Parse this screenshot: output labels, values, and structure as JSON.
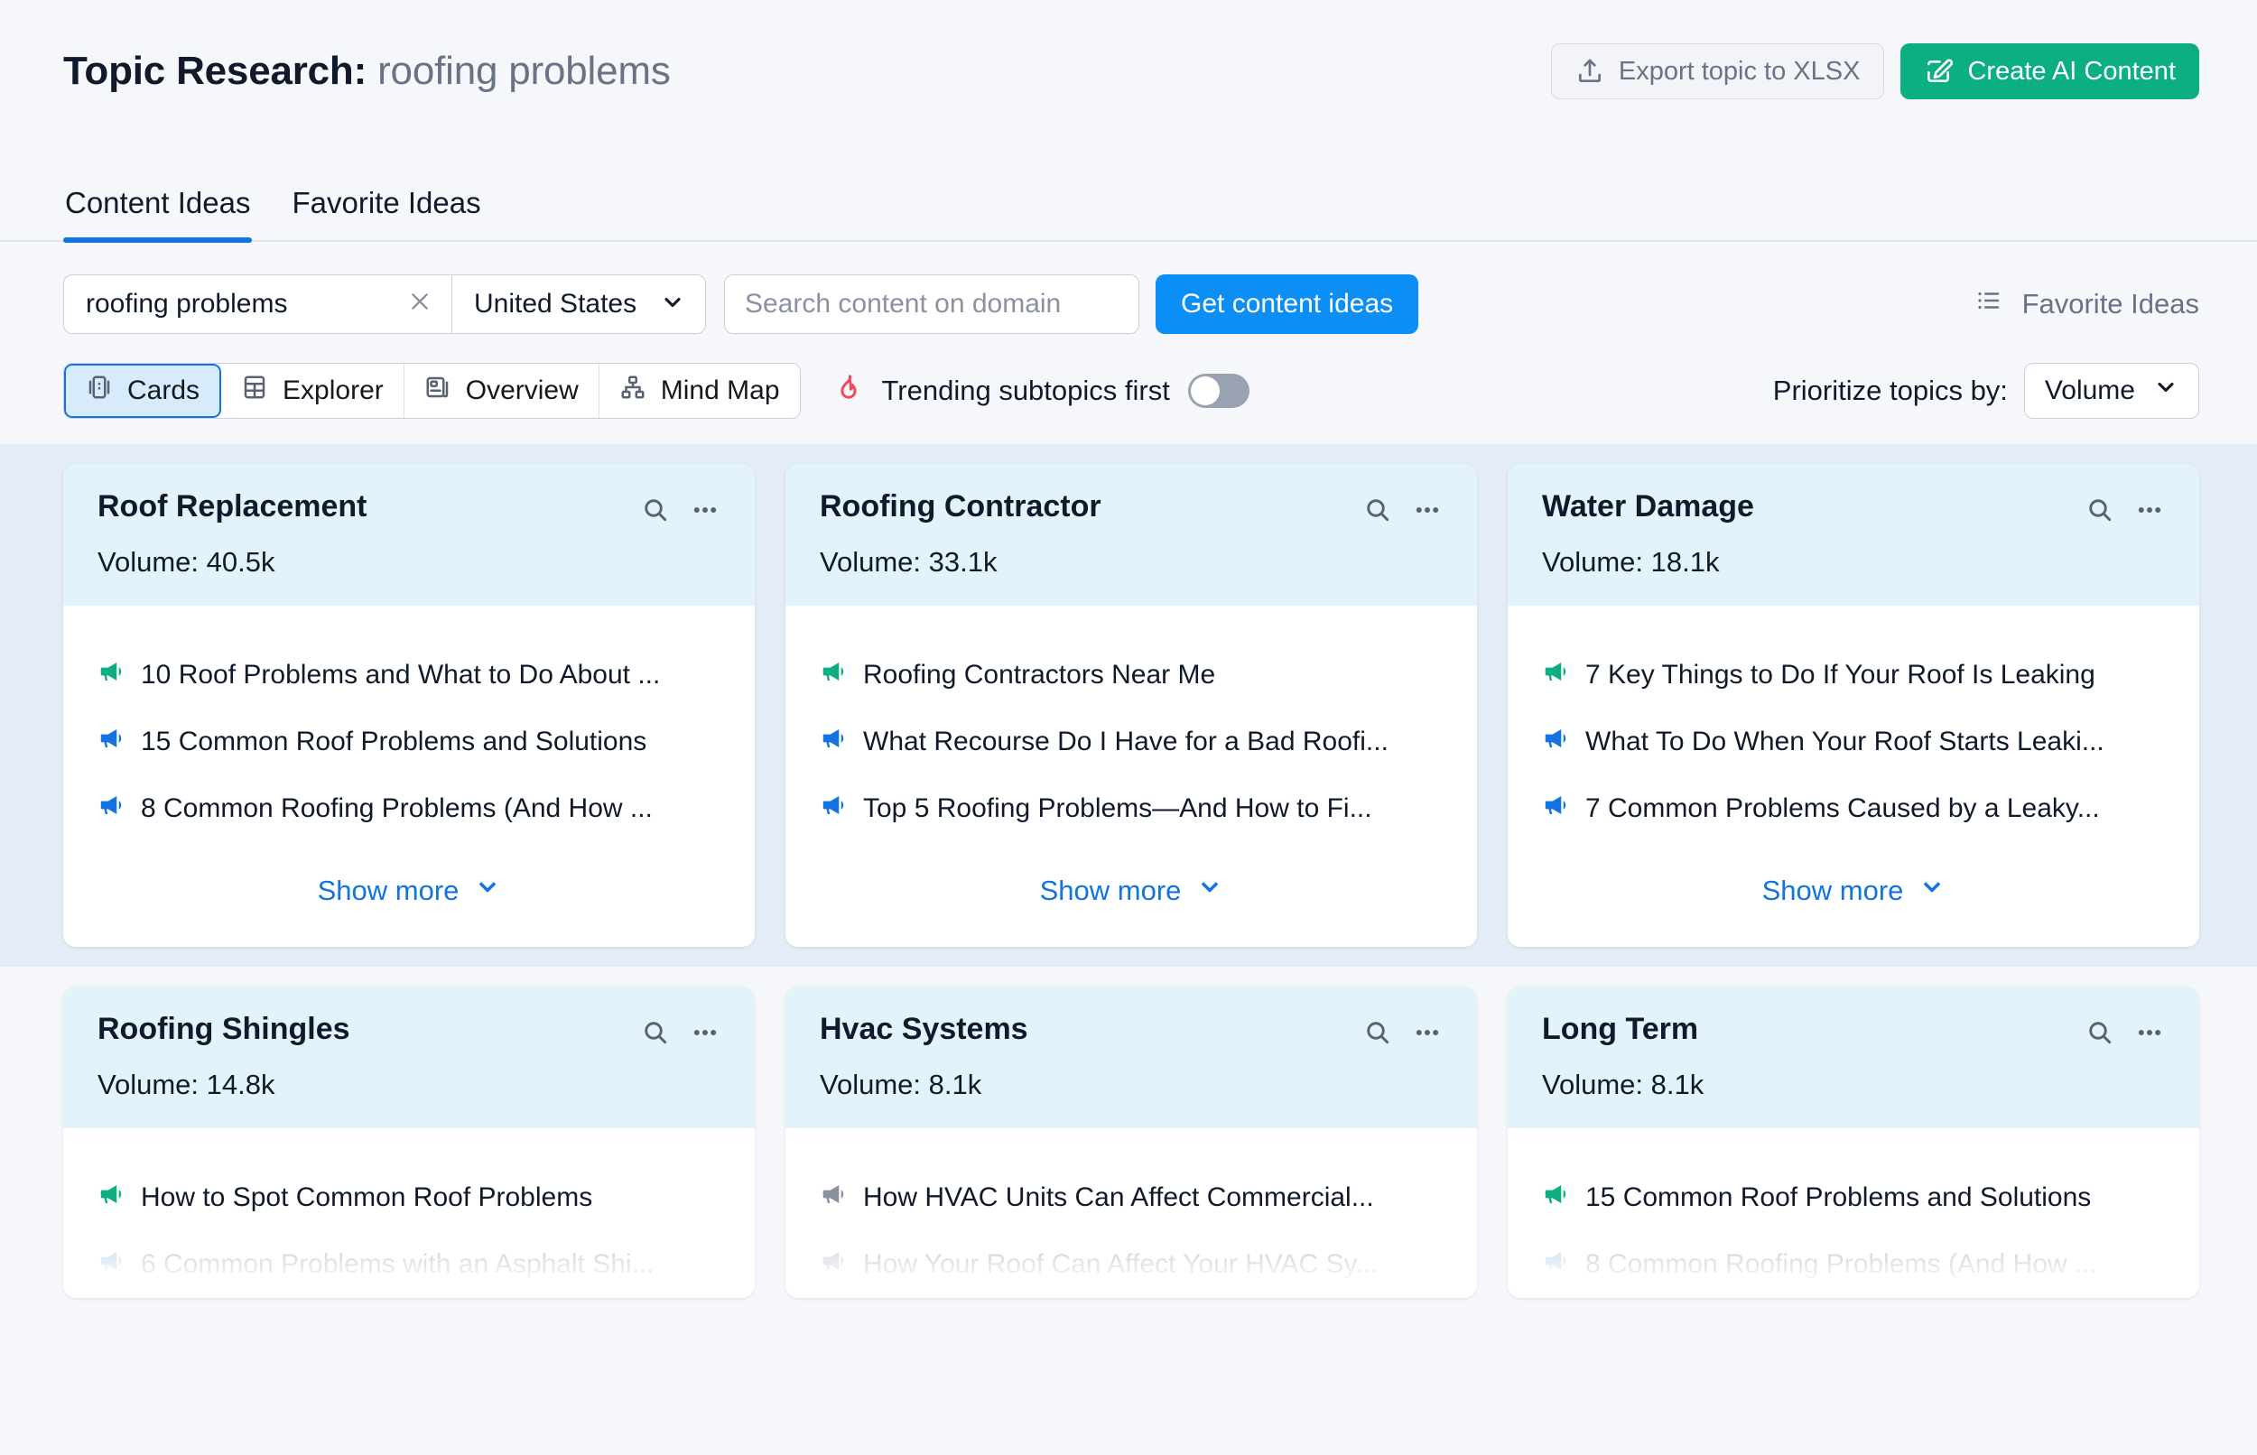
{
  "header": {
    "title_prefix": "Topic Research:",
    "title_keyword": "roofing problems",
    "export_label": "Export topic to XLSX",
    "create_label": "Create AI Content"
  },
  "tabs": [
    {
      "label": "Content Ideas",
      "active": true
    },
    {
      "label": "Favorite Ideas",
      "active": false
    }
  ],
  "controls": {
    "keyword_value": "roofing problems",
    "country_value": "United States",
    "domain_placeholder": "Search content on domain",
    "domain_value": "",
    "get_ideas_label": "Get content ideas",
    "favorite_ideas_label": "Favorite Ideas",
    "views": [
      {
        "label": "Cards",
        "icon": "cards-icon",
        "active": true
      },
      {
        "label": "Explorer",
        "icon": "table-icon",
        "active": false
      },
      {
        "label": "Overview",
        "icon": "overview-icon",
        "active": false
      },
      {
        "label": "Mind Map",
        "icon": "mindmap-icon",
        "active": false
      }
    ],
    "trending_label": "Trending subtopics first",
    "trending_enabled": false,
    "prioritize_label": "Prioritize topics by:",
    "prioritize_value": "Volume"
  },
  "colors": {
    "accent_blue": "#1274e0",
    "button_blue": "#0b8ef5",
    "brand_green": "#0caf81",
    "flame_red": "#f8455a",
    "card_header": "#e3f3fc",
    "highlight_band": "#e4ecf7"
  },
  "show_more_label": "Show more",
  "cards": [
    {
      "title": "Roof Replacement",
      "volume": "Volume: 40.5k",
      "ideas": [
        {
          "text": "10 Roof Problems and What to Do About ...",
          "tone": "green"
        },
        {
          "text": "15 Common Roof Problems and Solutions",
          "tone": "blue"
        },
        {
          "text": "8 Common Roofing Problems (And How ...",
          "tone": "blue"
        }
      ]
    },
    {
      "title": "Roofing Contractor",
      "volume": "Volume: 33.1k",
      "ideas": [
        {
          "text": "Roofing Contractors Near Me",
          "tone": "green"
        },
        {
          "text": "What Recourse Do I Have for a Bad Roofi...",
          "tone": "blue"
        },
        {
          "text": "Top 5 Roofing Problems—And How to Fi...",
          "tone": "blue"
        }
      ]
    },
    {
      "title": "Water Damage",
      "volume": "Volume: 18.1k",
      "ideas": [
        {
          "text": "7 Key Things to Do If Your Roof Is Leaking",
          "tone": "green"
        },
        {
          "text": "What To Do When Your Roof Starts Leaki...",
          "tone": "blue"
        },
        {
          "text": "7 Common Problems Caused by a Leaky...",
          "tone": "blue"
        }
      ]
    },
    {
      "title": "Roofing Shingles",
      "volume": "Volume: 14.8k",
      "ideas": [
        {
          "text": "How to Spot Common Roof Problems",
          "tone": "green"
        },
        {
          "text": "6 Common Problems with an Asphalt Shi...",
          "tone": "faded-blue"
        }
      ]
    },
    {
      "title": "Hvac Systems",
      "volume": "Volume: 8.1k",
      "ideas": [
        {
          "text": "How HVAC Units Can Affect Commercial...",
          "tone": "gray"
        },
        {
          "text": "How Your Roof Can Affect Your HVAC Sy...",
          "tone": "faded-gray"
        }
      ]
    },
    {
      "title": "Long Term",
      "volume": "Volume: 8.1k",
      "ideas": [
        {
          "text": "15 Common Roof Problems and Solutions",
          "tone": "green"
        },
        {
          "text": "8 Common Roofing Problems (And How ...",
          "tone": "faded-blue"
        }
      ]
    }
  ]
}
